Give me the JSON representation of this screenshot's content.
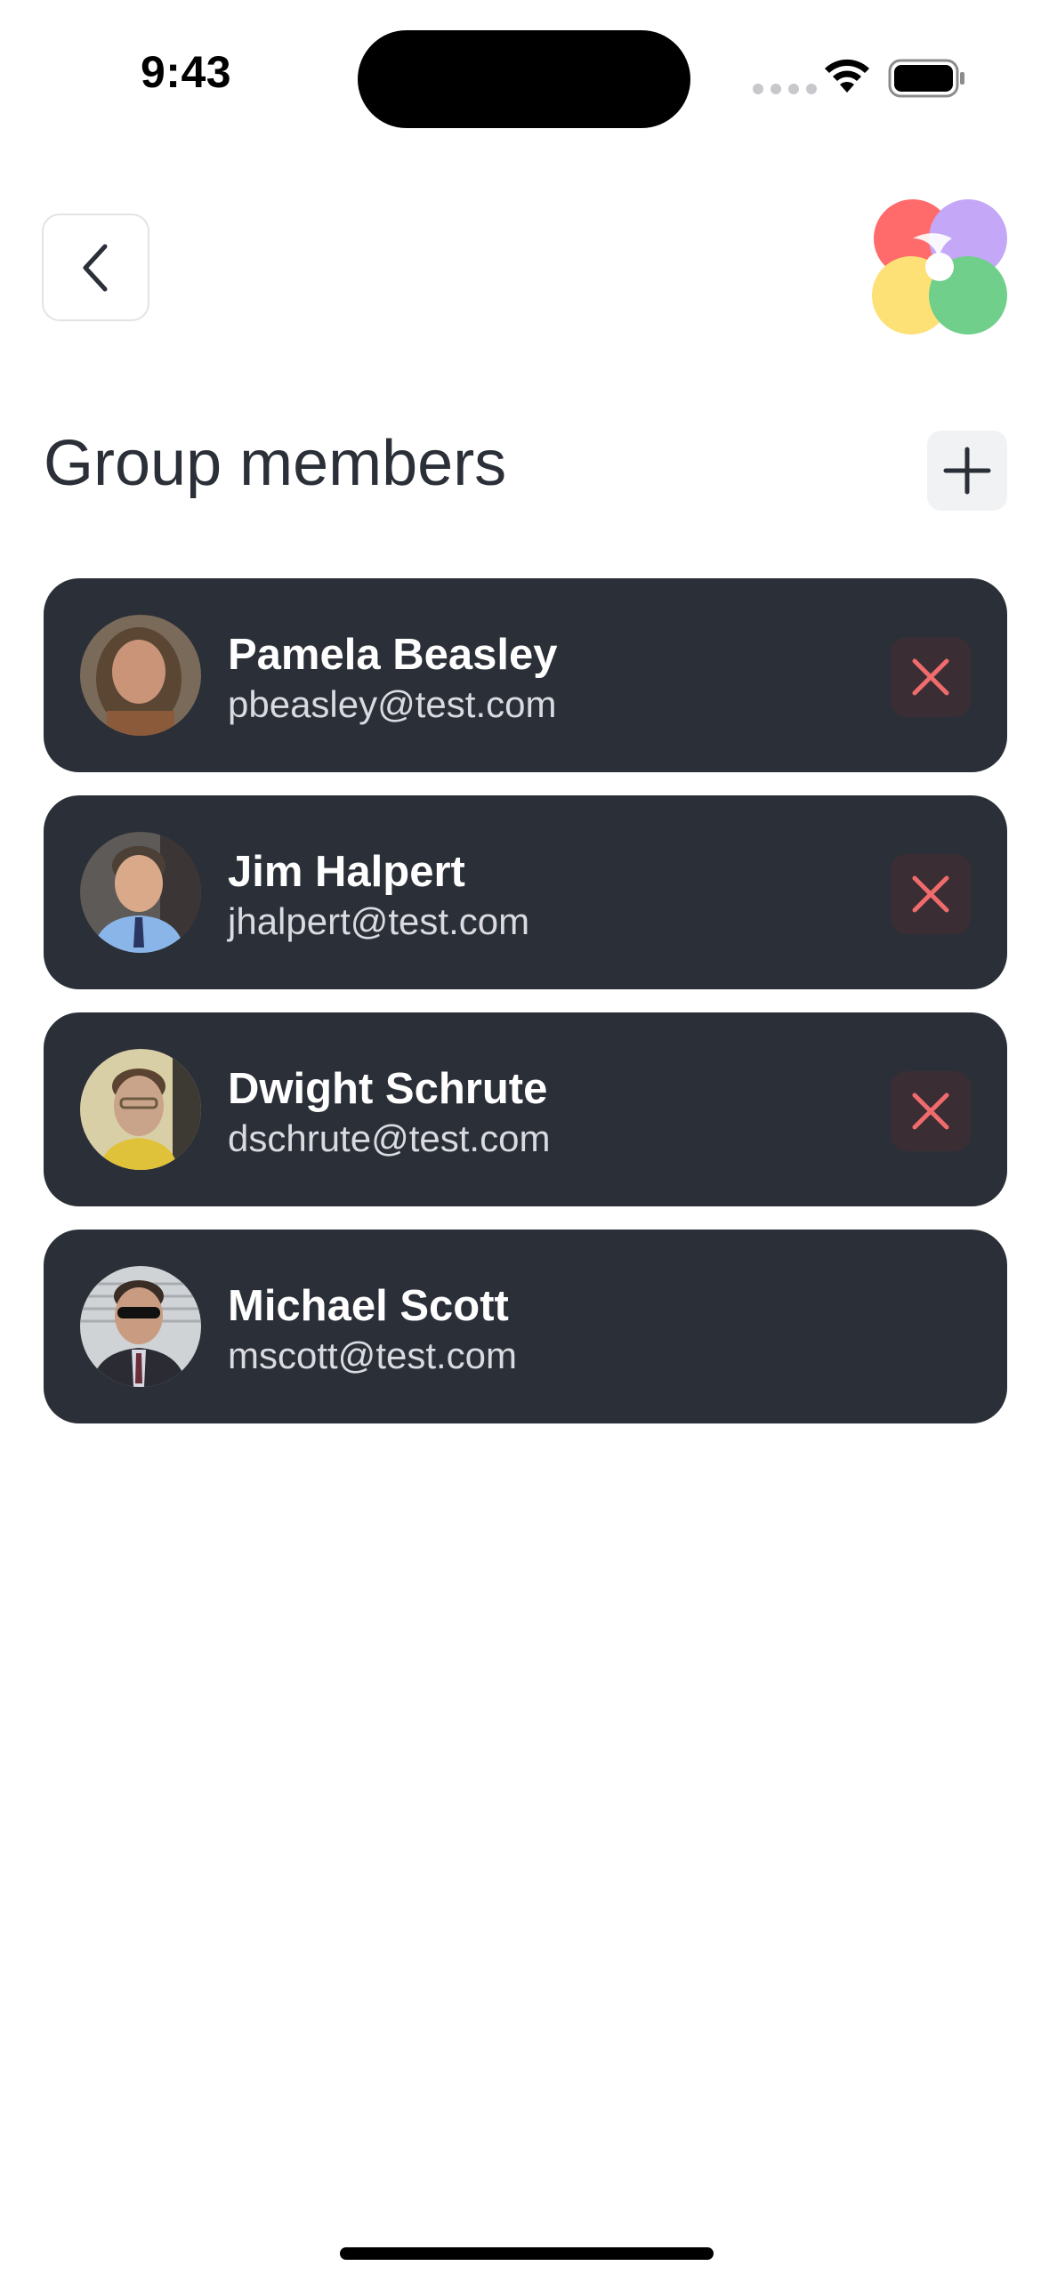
{
  "status_bar": {
    "time": "9:43"
  },
  "header": {
    "back_icon": "chevron-left-icon",
    "logo_colors": [
      "#ff6b6b",
      "#c4a8f7",
      "#fde177",
      "#6fcf8b"
    ]
  },
  "page": {
    "title": "Group members",
    "add_icon": "plus-icon"
  },
  "members": [
    {
      "name": "Pamela Beasley",
      "email": "pbeasley@test.com",
      "removable": true,
      "avatar_colors": [
        "#5a4633",
        "#c99478",
        "#8a5a3a"
      ]
    },
    {
      "name": "Jim Halpert",
      "email": "jhalpert@test.com",
      "removable": true,
      "avatar_colors": [
        "#4c4036",
        "#d9a989",
        "#8ab5e8"
      ]
    },
    {
      "name": "Dwight Schrute",
      "email": "dschrute@test.com",
      "removable": true,
      "avatar_colors": [
        "#d9cfa6",
        "#c9a48a",
        "#e0c23a"
      ]
    },
    {
      "name": "Michael Scott",
      "email": "mscott@test.com",
      "removable": false,
      "avatar_colors": [
        "#cfd3d6",
        "#c99c82",
        "#2a2b33"
      ]
    }
  ],
  "colors": {
    "card_bg": "#2b2f38",
    "remove_icon": "#f06b6b",
    "title": "#2b2f38"
  }
}
